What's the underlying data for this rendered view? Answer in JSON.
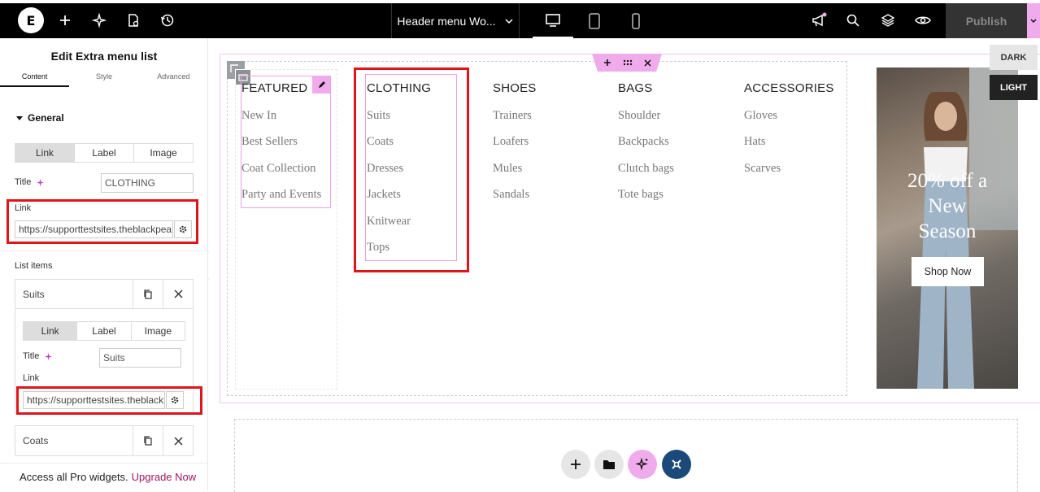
{
  "topbar": {
    "logo": "E",
    "document_title": "Header menu Wo...",
    "publish_label": "Publish",
    "icons": [
      "plus-icon",
      "sparkle-icon",
      "site-settings-icon",
      "history-icon",
      "megaphone-icon",
      "search-icon",
      "layers-icon",
      "preview-eye-icon"
    ],
    "devices": [
      "desktop",
      "tablet",
      "mobile"
    ],
    "active_device": "desktop"
  },
  "panel": {
    "title": "Edit Extra menu list",
    "tabs": [
      {
        "label": "Content",
        "active": true
      },
      {
        "label": "Style",
        "active": false
      },
      {
        "label": "Advanced",
        "active": false
      }
    ],
    "section_title": "General",
    "type_options": [
      "Link",
      "Label",
      "Image"
    ],
    "active_type": "Link",
    "title_label": "Title",
    "title_value": "CLOTHING",
    "link_label": "Link",
    "link_value": "https://supporttestsites.theblackpearls",
    "list_items_label": "List items",
    "list_items": [
      {
        "name": "Suits",
        "expanded": true,
        "type_options": [
          "Link",
          "Label",
          "Image"
        ],
        "active_type": "Link",
        "title_label": "Title",
        "title_value": "Suits",
        "link_label": "Link",
        "link_value": "https://supporttestsites.theblackpe"
      },
      {
        "name": "Coats",
        "expanded": false
      }
    ],
    "promo_text": "Access all Pro widgets.",
    "promo_link": "Upgrade Now"
  },
  "canvas": {
    "menu_columns": [
      {
        "heading": "FEATURED",
        "items": [
          "New In",
          "Best Sellers",
          "Coat Collection",
          "Party and Events"
        ]
      },
      {
        "heading": "CLOTHING",
        "items": [
          "Suits",
          "Coats",
          "Dresses",
          "Jackets",
          "Knitwear",
          "Tops"
        ]
      },
      {
        "heading": "SHOES",
        "items": [
          "Trainers",
          "Loafers",
          "Mules",
          "Sandals"
        ]
      },
      {
        "heading": "BAGS",
        "items": [
          "Shoulder",
          "Backpacks",
          "Clutch bags",
          "Tote bags"
        ]
      },
      {
        "heading": "ACCESSORIES",
        "items": [
          "Gloves",
          "Hats",
          "Scarves"
        ]
      }
    ],
    "promo": {
      "line1": "20% off a",
      "line2": "New",
      "line3": "Season",
      "button": "Shop Now"
    },
    "mode_dark": "DARK",
    "mode_light": "LIGHT"
  },
  "colors": {
    "accent_pink": "#f0abec",
    "highlight_red": "#e0151b",
    "upgrade_link": "#a01561",
    "ai_button": "#f0abec",
    "navigator_button": "#1b4a7a"
  }
}
